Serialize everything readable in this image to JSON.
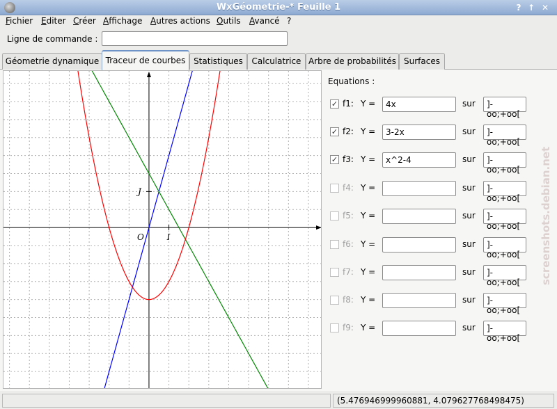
{
  "window": {
    "title": "WxGéometrie-* Feuille 1",
    "controls": [
      "?",
      "↑",
      "✕"
    ]
  },
  "menu": [
    "Fichier",
    "Editer",
    "Créer",
    "Affichage",
    "Autres actions",
    "Outils",
    "Avancé",
    "?"
  ],
  "command": {
    "label": "Ligne de commande :",
    "value": ""
  },
  "tabs": [
    {
      "label": "Géometrie dynamique",
      "active": false
    },
    {
      "label": "Traceur de courbes",
      "active": true
    },
    {
      "label": "Statistiques",
      "active": false
    },
    {
      "label": "Calculatrice",
      "active": false
    },
    {
      "label": "Arbre de probabilités",
      "active": false
    },
    {
      "label": "Surfaces",
      "active": false
    }
  ],
  "plot": {
    "origin_label": "O",
    "unit_x_label": "I",
    "unit_y_label": "J",
    "xrange": [
      -7.3,
      8.7
    ],
    "yrange": [
      -9,
      8.7
    ],
    "colors": {
      "f1": "#0000ff",
      "f2": "#008800",
      "f3": "#ff0000",
      "axes": "#000000",
      "grid": "#b0b0b0"
    },
    "grid": true
  },
  "equations": {
    "header": "Equations :",
    "y_label": "Y =",
    "sur_label": "sur",
    "rows": [
      {
        "name": "f1:",
        "expr": "4x",
        "domain": "]-oo;+oo[",
        "checked": true
      },
      {
        "name": "f2:",
        "expr": "3-2x",
        "domain": "]-oo;+oo[",
        "checked": true
      },
      {
        "name": "f3:",
        "expr": "x^2-4",
        "domain": "]-oo;+oo[",
        "checked": true
      },
      {
        "name": "f4:",
        "expr": "",
        "domain": "]-oo;+oo[",
        "checked": false
      },
      {
        "name": "f5:",
        "expr": "",
        "domain": "]-oo;+oo[",
        "checked": false
      },
      {
        "name": "f6:",
        "expr": "",
        "domain": "]-oo;+oo[",
        "checked": false
      },
      {
        "name": "f7:",
        "expr": "",
        "domain": "]-oo;+oo[",
        "checked": false
      },
      {
        "name": "f8:",
        "expr": "",
        "domain": "]-oo;+oo[",
        "checked": false
      },
      {
        "name": "f9:",
        "expr": "",
        "domain": "]-oo;+oo[",
        "checked": false
      }
    ]
  },
  "status": {
    "left": "",
    "coordinates": "(5.476946999960881, 4.079627768498475)"
  },
  "watermark": "screenshots.debian.net"
}
